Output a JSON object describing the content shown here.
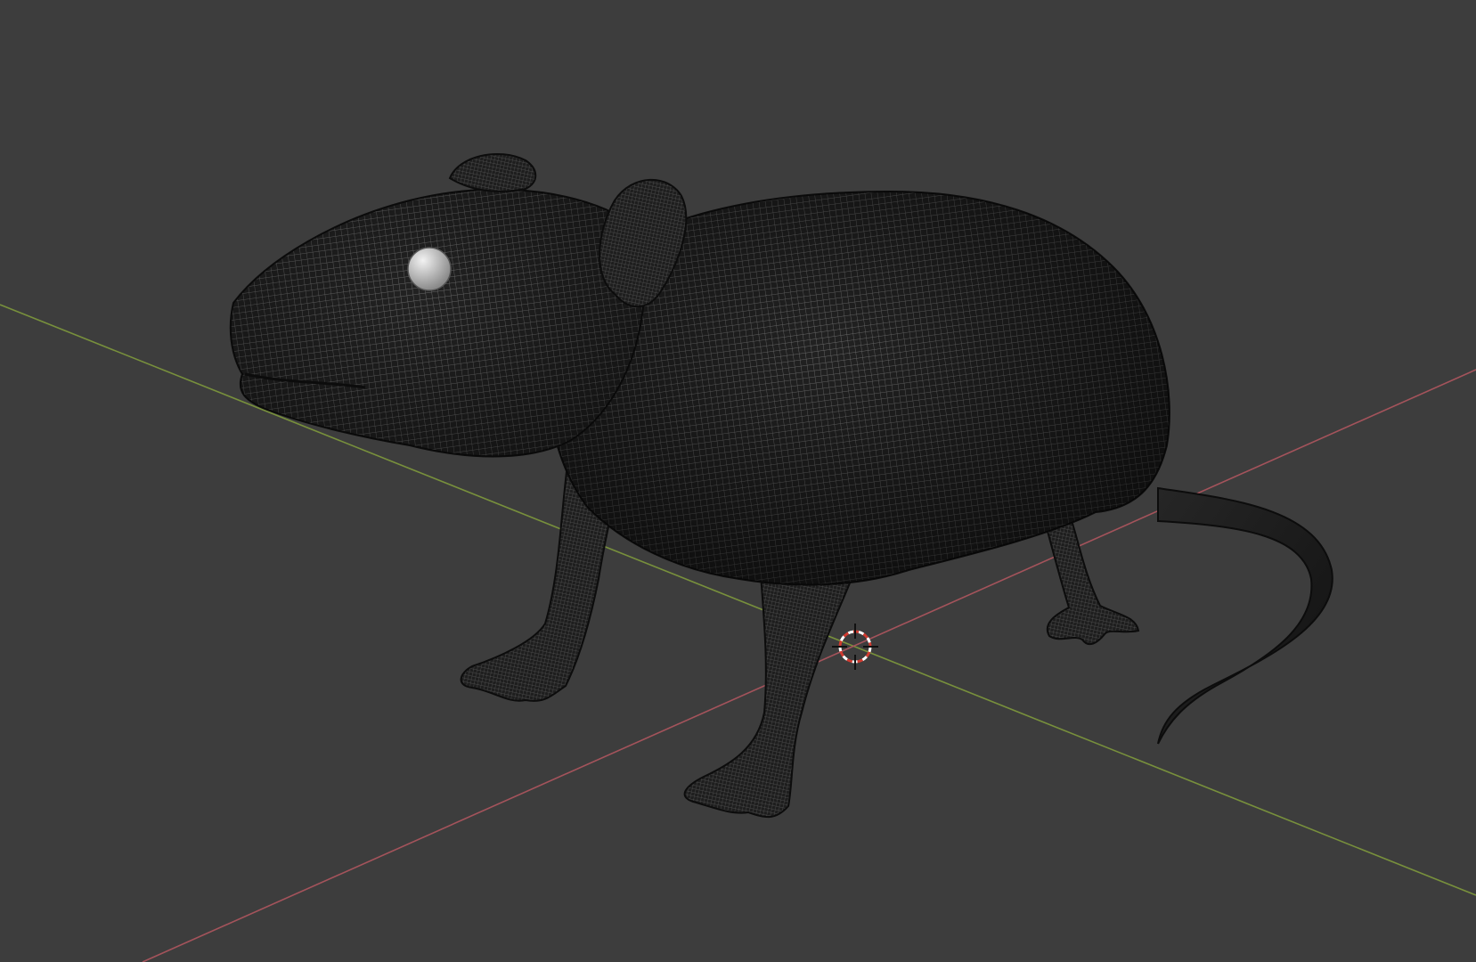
{
  "viewport": {
    "background_color": "#3d3d3d",
    "x_axis_color": "#b0565f",
    "y_axis_color": "#7f9a3c",
    "model_base_color": "#1c1c1c",
    "wire_color": "#6a6a6a",
    "eye_color": "#cfcfcf",
    "cursor_colors": [
      "#d23a2f",
      "#ffffff"
    ]
  },
  "scene": {
    "object": "rat-mesh",
    "shading": "wireframe-overlay",
    "cursor": "3d-cursor-icon"
  }
}
